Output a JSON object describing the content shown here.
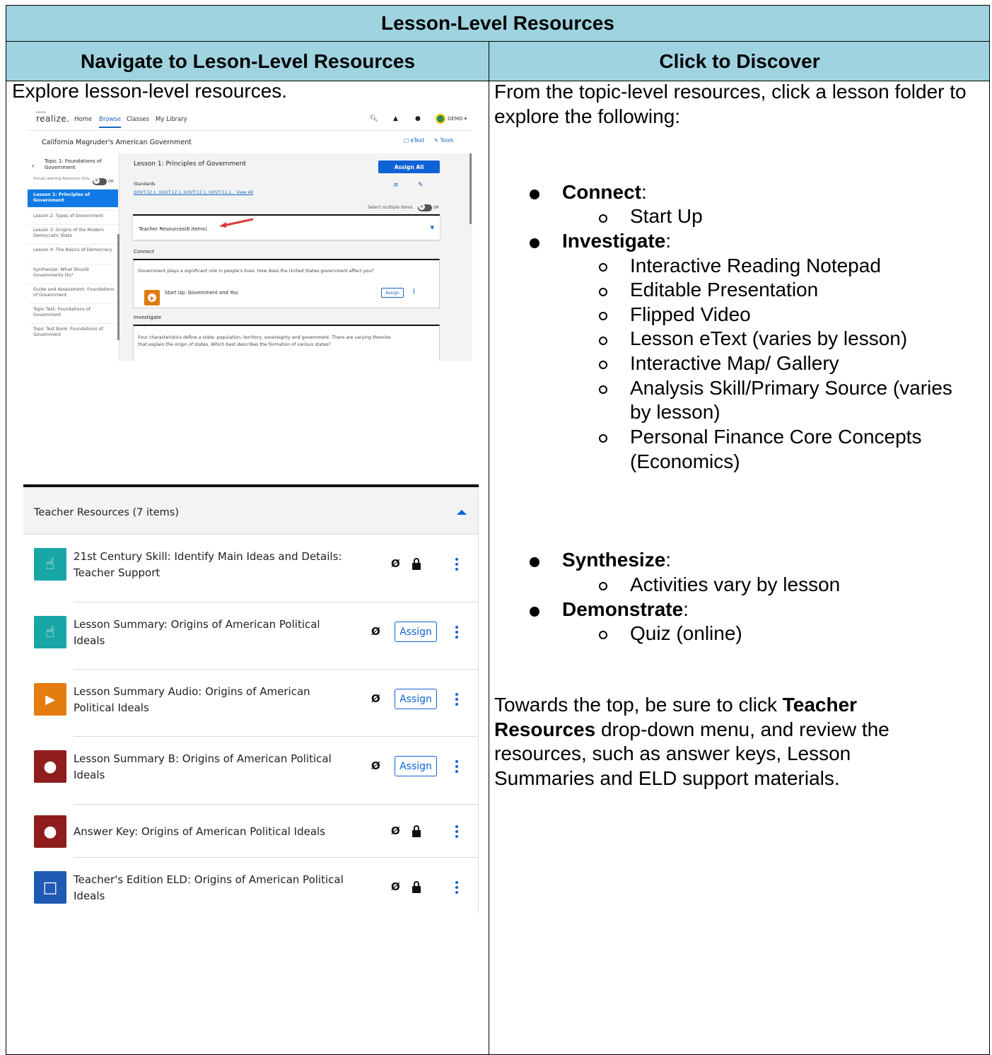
{
  "table": {
    "title": "Lesson-Level Resources",
    "col_left_header": "Navigate to Leson-Level Resources",
    "col_right_header": "Click to Discover"
  },
  "left": {
    "intro": "Explore lesson-level resources."
  },
  "right": {
    "intro": "From the topic-level resources, click a lesson folder to explore the following:",
    "groups": [
      {
        "label": "Connect",
        "items": [
          "Start Up"
        ]
      },
      {
        "label": "Investigate",
        "items": [
          "Interactive Reading Notepad",
          "Editable Presentation",
          "Flipped Video",
          "Lesson eText (varies by lesson)",
          "Interactive Map/ Gallery",
          "Analysis Skill/Primary Source (varies",
          "by lesson)",
          "Personal Finance Core Concepts",
          "(Economics)"
        ]
      },
      {
        "label": "Synthesize",
        "items": [
          "Activities vary by lesson"
        ]
      },
      {
        "label": "Demonstrate",
        "items": [
          "Quiz (online)"
        ]
      }
    ],
    "closing_pre": "Towards the top, be sure to click ",
    "closing_bold": "Teacher Resources",
    "closing_post": " drop-down menu, and review the resources, such as answer keys, Lesson Summaries and ELD support materials."
  },
  "screenshot1": {
    "logo_small": "savvas",
    "logo": "realize.",
    "nav": [
      "Home",
      "Browse",
      "Classes",
      "My Library"
    ],
    "user": "DEMO",
    "course_title": "California Magruder's American Government",
    "etext": "eText",
    "tools": "Tools",
    "topic": "Topic 1: Foundations of Government",
    "vlr": "Virtual Learning Resources Only",
    "off": "Off",
    "sidebar_items": [
      "Lesson 1: Principles of Government",
      "Lesson 2: Types of Government",
      "Lesson 3: Origins of the Modern Democratic State",
      "Lesson 4: The Basics of Democracy",
      "Synthesize: What Should Governments Do?",
      "Guide and Assessment: Foundations of Government",
      "Topic Test: Foundations of Government",
      "Topic Test Bank: Foundations of Government"
    ],
    "lesson_title": "Lesson 1: Principles of Government",
    "assign_all": "Assign All",
    "standards_label": "Standards",
    "standards_links": "GOVT.12.1, GOVT.12.1, GOVT.12.1, GOVT.12.1... View All",
    "select_multiple": "Select multiple items",
    "teacher_resources": "Teacher Resources(6 items)",
    "connect": "Connect",
    "connect_text": "Government plays a significant role in people's lives. How does the United States government affect you?",
    "startup": "Start Up: Government and You",
    "assign": "Assign",
    "investigate": "Investigate",
    "investigate_text_1": "Four characteristics define a state: population, territory, sovereignty and government. There are varying theories",
    "investigate_text_2": "that explain the origin of states. Which best describes the formation of various states?"
  },
  "screenshot2": {
    "header": "Teacher Resources (7 items)",
    "assign_label": "Assign",
    "rows": [
      {
        "title": "21st Century Skill: Identify Main Ideas and Details: Teacher Support",
        "icon": "hand-pointer-icon",
        "color": "#19a6a6",
        "state": "locked"
      },
      {
        "title": "Lesson Summary: Origins of American Political Ideals",
        "icon": "hand-pointer-icon",
        "color": "#19a6a6",
        "state": "assign"
      },
      {
        "title": "Lesson Summary Audio: Origins of American Political Ideals",
        "icon": "play-icon",
        "color": "#e57c0f",
        "state": "assign"
      },
      {
        "title": "Lesson Summary B: Origins of American Political Ideals",
        "icon": "apple-icon",
        "color": "#8f1d1d",
        "state": "assign"
      },
      {
        "title": "Answer Key: Origins of American Political Ideals",
        "icon": "apple-icon",
        "color": "#8f1d1d",
        "state": "locked"
      },
      {
        "title": "Teacher's Edition ELD: Origins of American Political Ideals",
        "icon": "book-icon",
        "color": "#1f5bb5",
        "state": "locked"
      }
    ]
  }
}
